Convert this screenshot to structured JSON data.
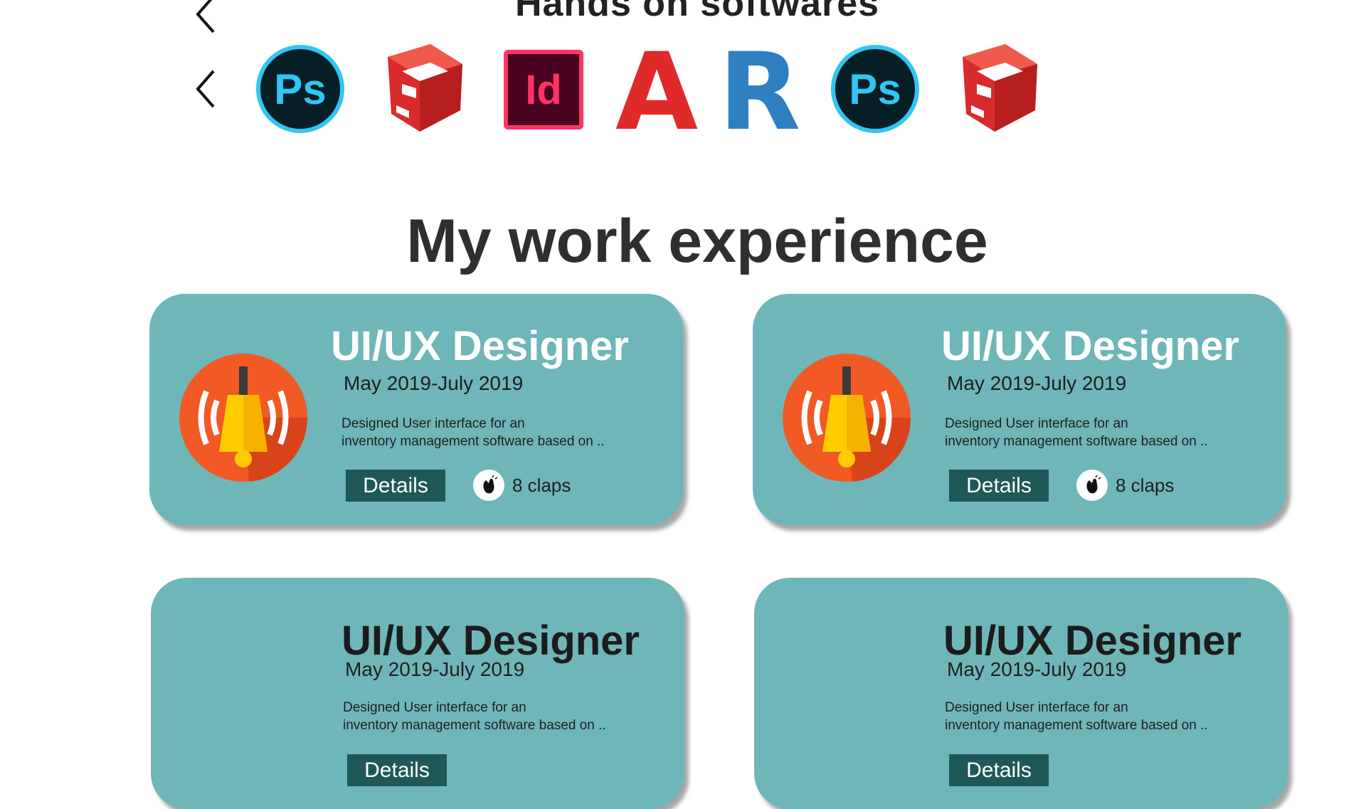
{
  "software_section": {
    "title": "Hands on softwares",
    "logos": [
      {
        "name": "photoshop",
        "label": "Ps",
        "color": "#31c5f4"
      },
      {
        "name": "sketchup",
        "label": "",
        "color": "#d92b2b"
      },
      {
        "name": "indesign",
        "label": "Id",
        "color": "#ff3366"
      },
      {
        "name": "autocad",
        "label": "A",
        "color": "#e02a2a"
      },
      {
        "name": "revit",
        "label": "R",
        "color": "#2f7fc1"
      },
      {
        "name": "photoshop",
        "label": "Ps",
        "color": "#31c5f4"
      },
      {
        "name": "sketchup",
        "label": "",
        "color": "#d92b2b"
      }
    ]
  },
  "experience": {
    "title": "My work experience",
    "cards": [
      {
        "title": "UI/UX Designer",
        "date": "May 2019-July 2019",
        "desc_line1": "Designed User interface for an",
        "desc_line2": "inventory management software based on ..",
        "details": "Details",
        "claps": "8 claps"
      },
      {
        "title": "UI/UX Designer",
        "date": "May 2019-July 2019",
        "desc_line1": "Designed User interface for an",
        "desc_line2": "inventory management software based on ..",
        "details": "Details",
        "claps": "8 claps"
      },
      {
        "title": "UI/UX Designer",
        "date": "May 2019-July 2019",
        "desc_line1": "Designed User interface for an",
        "desc_line2": "inventory management software based on ..",
        "details": "Details",
        "claps": ""
      },
      {
        "title": "UI/UX Designer",
        "date": "May 2019-July 2019",
        "desc_line1": "Designed User interface for an",
        "desc_line2": "inventory management software based on ..",
        "details": "Details",
        "claps": ""
      }
    ]
  },
  "colors": {
    "card_bg": "#6fb6b8",
    "button_bg": "#1f5957",
    "heading": "#2f2f2f"
  },
  "icons": [
    "chevron-left-icon",
    "photoshop-icon",
    "sketchup-icon",
    "indesign-icon",
    "autocad-icon",
    "revit-icon",
    "bell-icon",
    "clap-icon"
  ]
}
